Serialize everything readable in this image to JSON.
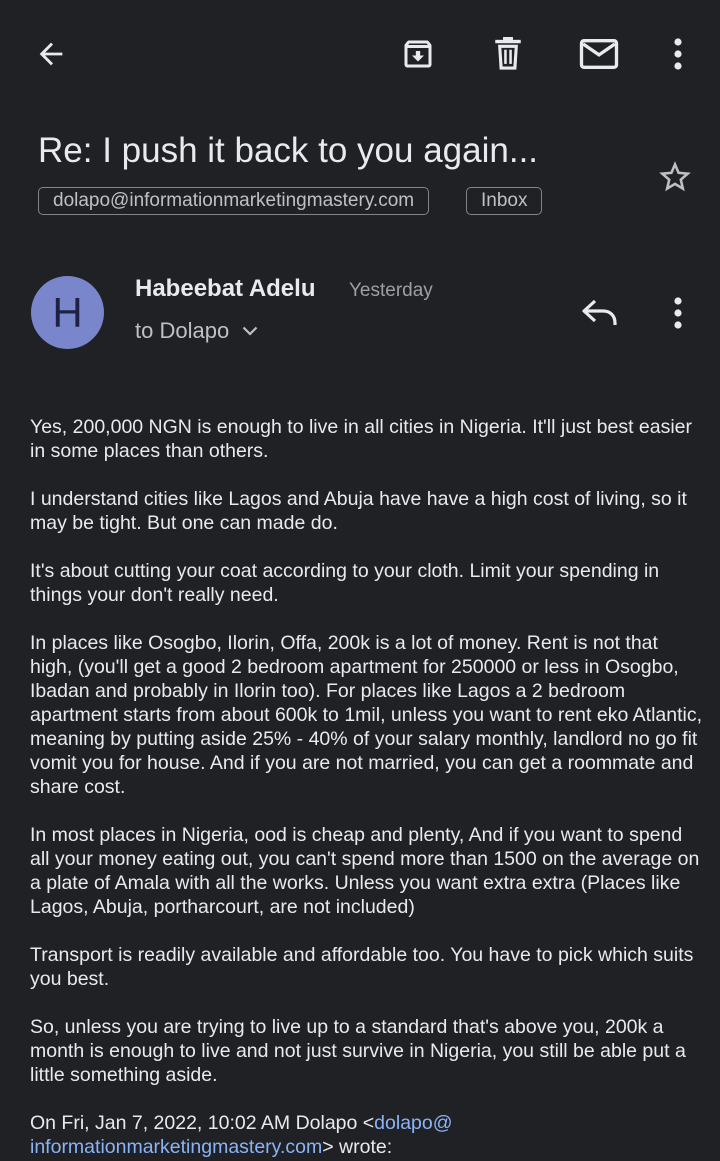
{
  "toolbar": {
    "back_icon": "arrow-left-icon",
    "archive_icon": "archive-icon",
    "delete_icon": "trash-icon",
    "mark_unread_icon": "envelope-icon",
    "more_icon": "more-vertical-icon"
  },
  "email": {
    "subject": "Re: I push it back to you again...",
    "labels": {
      "address": "dolapo@informationmarketingmastery.com",
      "folder": "Inbox"
    },
    "star_icon": "star-outline-icon",
    "sender": {
      "initial": "H",
      "name": "Habeebat Adelu",
      "time": "Yesterday",
      "recipients": "to Dolapo",
      "avatar_color": "#7986cb"
    },
    "reply_icon": "reply-icon",
    "more_icon": "more-vertical-icon",
    "body": [
      "Yes, 200,000 NGN is enough to live in all cities in Nigeria. It'll just best easier in some places than others.",
      "I understand cities like Lagos and Abuja have have a high cost of living, so it may be tight. But one can made do.",
      "It's about cutting your coat according to your cloth. Limit your spending in things your don't really need.",
      "In places like Osogbo, Ilorin, Offa, 200k is a lot of money. Rent is not that high, (you'll get a good 2 bedroom apartment for 250000 or less in Osogbo, Ibadan and probably in Ilorin too).  For places like Lagos a 2 bedroom apartment starts from about 600k to 1mil, unless you want to rent eko Atlantic, meaning by putting aside 25% - 40% of your salary monthly, landlord no go fit vomit you for house. And if you are not married, you can get a roommate and share cost.",
      "In most places in Nigeria, ood is cheap and plenty,  And if you want to spend all your money eating out, you can't spend more than 1500 on the average on a plate of  Amala with all the works. Unless you want extra extra (Places like Lagos, Abuja, portharcourt, are not included)",
      "Transport is readily available and affordable too. You have to pick which suits you best.",
      "So, unless you are trying to live up to a standard that's above you, 200k a month is enough to live and not just survive in Nigeria, you still be able put a little something aside."
    ],
    "quote": {
      "prefix": "On Fri, Jan 7, 2022, 10:02 AM Dolapo <",
      "email": "dolapo@ informationmarketingmastery.com",
      "suffix": "> wrote:"
    }
  },
  "colors": {
    "background": "#202124",
    "text": "#e8eaed",
    "secondary_text": "#bdc1c6",
    "link": "#8ab4f8"
  }
}
